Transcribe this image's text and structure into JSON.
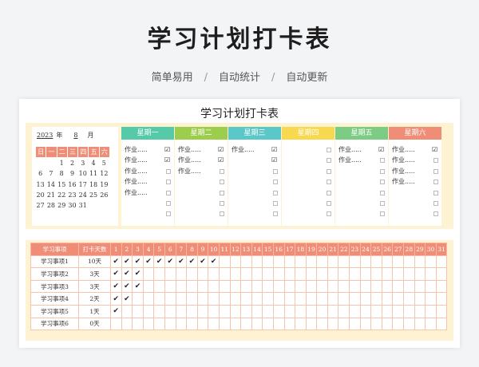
{
  "page": {
    "title": "学习计划打卡表",
    "features": [
      "简单易用",
      "自动统计",
      "自动更新"
    ],
    "separator": "/"
  },
  "sheet": {
    "title": "学习计划打卡表",
    "calendar": {
      "year": "2023",
      "year_label": "年",
      "month": "8",
      "month_label": "月",
      "weekdays": [
        "日",
        "一",
        "二",
        "三",
        "四",
        "五",
        "六"
      ],
      "weeks": [
        [
          "",
          "",
          "1",
          "2",
          "3",
          "4",
          "5"
        ],
        [
          "6",
          "7",
          "8",
          "9",
          "10",
          "11",
          "12"
        ],
        [
          "13",
          "14",
          "15",
          "16",
          "17",
          "18",
          "19"
        ],
        [
          "20",
          "21",
          "22",
          "23",
          "24",
          "25",
          "26"
        ],
        [
          "27",
          "28",
          "29",
          "30",
          "31",
          "",
          ""
        ]
      ]
    },
    "days": [
      {
        "name": "星期一",
        "color": "#56c9a9",
        "tasks": [
          "作业.....",
          "作业.....",
          "作业.....",
          "作业.....",
          "作业....."
        ],
        "checks": [
          true,
          true,
          false,
          false,
          false,
          false,
          false
        ]
      },
      {
        "name": "星期二",
        "color": "#9ccd4d",
        "tasks": [
          "作业.....",
          "作业.....",
          "作业....."
        ],
        "checks": [
          true,
          true,
          false,
          false,
          false,
          false,
          false
        ]
      },
      {
        "name": "星期三",
        "color": "#5bc7c8",
        "tasks": [
          "作业....."
        ],
        "checks": [
          true,
          true,
          false,
          false,
          false,
          false,
          false
        ]
      },
      {
        "name": "星期四",
        "color": "#f8d84f",
        "tasks": [],
        "checks": [
          false,
          false,
          false,
          false,
          false,
          false,
          false
        ]
      },
      {
        "name": "星期五",
        "color": "#7dcc83",
        "tasks": [
          "作业.....",
          "作业....."
        ],
        "checks": [
          true,
          false,
          false,
          false,
          false,
          false,
          false
        ]
      },
      {
        "name": "星期六",
        "color": "#ef8d76",
        "tasks": [
          "作业.....",
          "作业.....",
          "作业.....",
          "作业....."
        ],
        "checks": [
          true,
          false,
          false,
          false,
          false,
          false,
          false
        ]
      }
    ],
    "table": {
      "header_item": "学习事项",
      "header_days": "打卡天数",
      "day_numbers": [
        "1",
        "2",
        "3",
        "4",
        "5",
        "6",
        "7",
        "8",
        "9",
        "10",
        "11",
        "12",
        "13",
        "14",
        "15",
        "16",
        "17",
        "18",
        "19",
        "20",
        "21",
        "22",
        "23",
        "24",
        "25",
        "26",
        "27",
        "28",
        "29",
        "30",
        "31"
      ],
      "check_symbol": "✔",
      "rows": [
        {
          "item": "学习事项1",
          "count": "10天",
          "checked_days": 10
        },
        {
          "item": "学习事项2",
          "count": "3天",
          "checked_days": 3
        },
        {
          "item": "学习事项3",
          "count": "3天",
          "checked_days": 3
        },
        {
          "item": "学习事项4",
          "count": "2天",
          "checked_days": 2
        },
        {
          "item": "学习事项5",
          "count": "1天",
          "checked_days": 1
        },
        {
          "item": "学习事项6",
          "count": "0天",
          "checked_days": 0
        }
      ]
    }
  }
}
